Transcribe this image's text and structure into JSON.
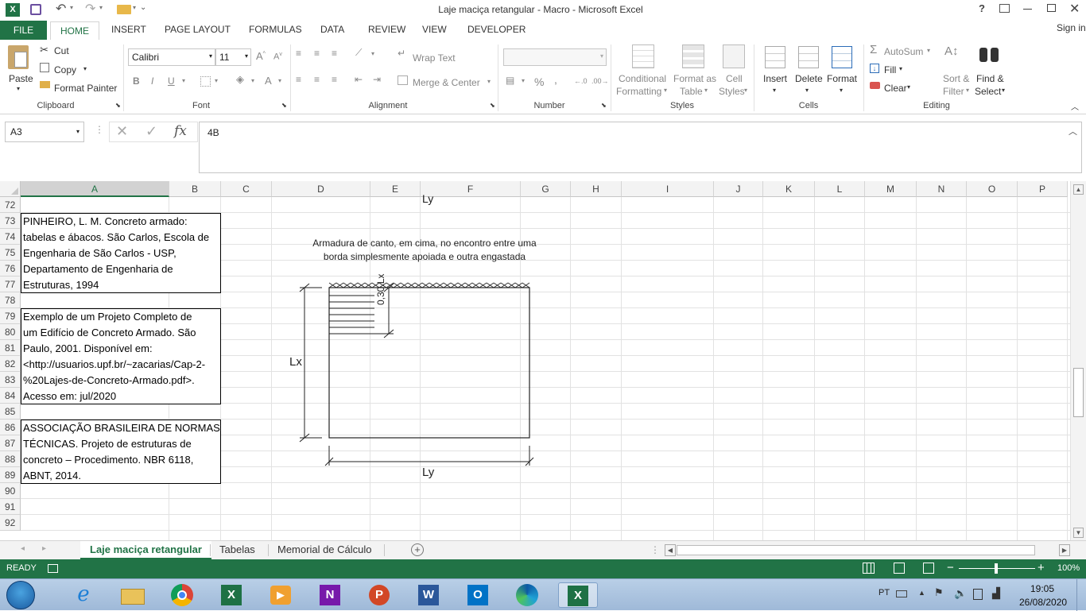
{
  "window": {
    "title": "Laje maciça retangular - Macro - Microsoft Excel",
    "help": "?",
    "controls": [
      "restore-ribbon",
      "minimize",
      "maximize",
      "close"
    ]
  },
  "ribbon_tabs": [
    "FILE",
    "HOME",
    "INSERT",
    "PAGE LAYOUT",
    "FORMULAS",
    "DATA",
    "REVIEW",
    "VIEW",
    "DEVELOPER"
  ],
  "active_tab": "HOME",
  "sign_in": "Sign in",
  "clipboard": {
    "paste": "Paste",
    "cut": "Cut",
    "copy": "Copy",
    "format_painter": "Format Painter",
    "label": "Clipboard"
  },
  "font": {
    "name": "Calibri",
    "size": "11",
    "bold": "B",
    "italic": "I",
    "underline": "U",
    "label": "Font"
  },
  "alignment": {
    "wrap": "Wrap Text",
    "merge": "Merge & Center",
    "label": "Alignment"
  },
  "number": {
    "format": "",
    "percent": "%",
    "comma": ",",
    "label": "Number"
  },
  "styles": {
    "conditional": "Conditional",
    "conditional2": "Formatting",
    "format_table": "Format as",
    "format_table2": "Table",
    "cell_styles": "Cell",
    "cell_styles2": "Styles",
    "label": "Styles"
  },
  "cells": {
    "insert": "Insert",
    "delete": "Delete",
    "format": "Format",
    "label": "Cells"
  },
  "editing": {
    "autosum": "AutoSum",
    "fill": "Fill",
    "clear": "Clear",
    "sort": "Sort &",
    "sort2": "Filter",
    "find": "Find &",
    "find2": "Select",
    "label": "Editing"
  },
  "formula_bar": {
    "name_box": "A3",
    "fx": "fx",
    "value": "4B"
  },
  "columns": [
    "A",
    "B",
    "C",
    "D",
    "E",
    "F",
    "G",
    "H",
    "I",
    "J",
    "K",
    "L",
    "M",
    "N",
    "O",
    "P"
  ],
  "rows": [
    "72",
    "73",
    "74",
    "75",
    "76",
    "77",
    "78",
    "79",
    "80",
    "81",
    "82",
    "83",
    "84",
    "85",
    "86",
    "87",
    "88",
    "89",
    "90",
    "91",
    "92"
  ],
  "references": [
    [
      "PINHEIRO, L. M. Concreto armado:",
      "tabelas e ábacos. São Carlos, Escola de",
      "Engenharia de São Carlos - USP,",
      "Departamento de Engenharia de",
      "Estruturas, 1994"
    ],
    [
      "Exemplo de um Projeto Completo de",
      "um Edifício de Concreto Armado. São",
      "Paulo, 2001. Disponível em:",
      "<http://usuarios.upf.br/~zacarias/Cap-2-",
      "%20Lajes-de-Concreto-Armado.pdf>.",
      "Acesso em: jul/2020"
    ],
    [
      "ASSOCIAÇÃO BRASILEIRA DE NORMAS",
      "TÉCNICAS. Projeto de estruturas de",
      "concreto – Procedimento. NBR 6118,",
      "ABNT, 2014."
    ]
  ],
  "drawing": {
    "top_label": "Ly",
    "caption1": "Armadura de canto, em cima, no encontro entre uma",
    "caption2": "borda simplesmente apoiada e outra engastada",
    "lx_label": "Lx",
    "ly_label": "Ly",
    "corner_label": "0,30.Lx"
  },
  "sheets": [
    "Laje maciça retangular",
    "Tabelas",
    "Memorial de Cálculo"
  ],
  "active_sheet": "Laje maciça retangular",
  "status": {
    "ready": "READY",
    "zoom": "100%"
  },
  "taskbar": {
    "lang": "PT",
    "time": "19:05",
    "date": "26/08/2020"
  }
}
